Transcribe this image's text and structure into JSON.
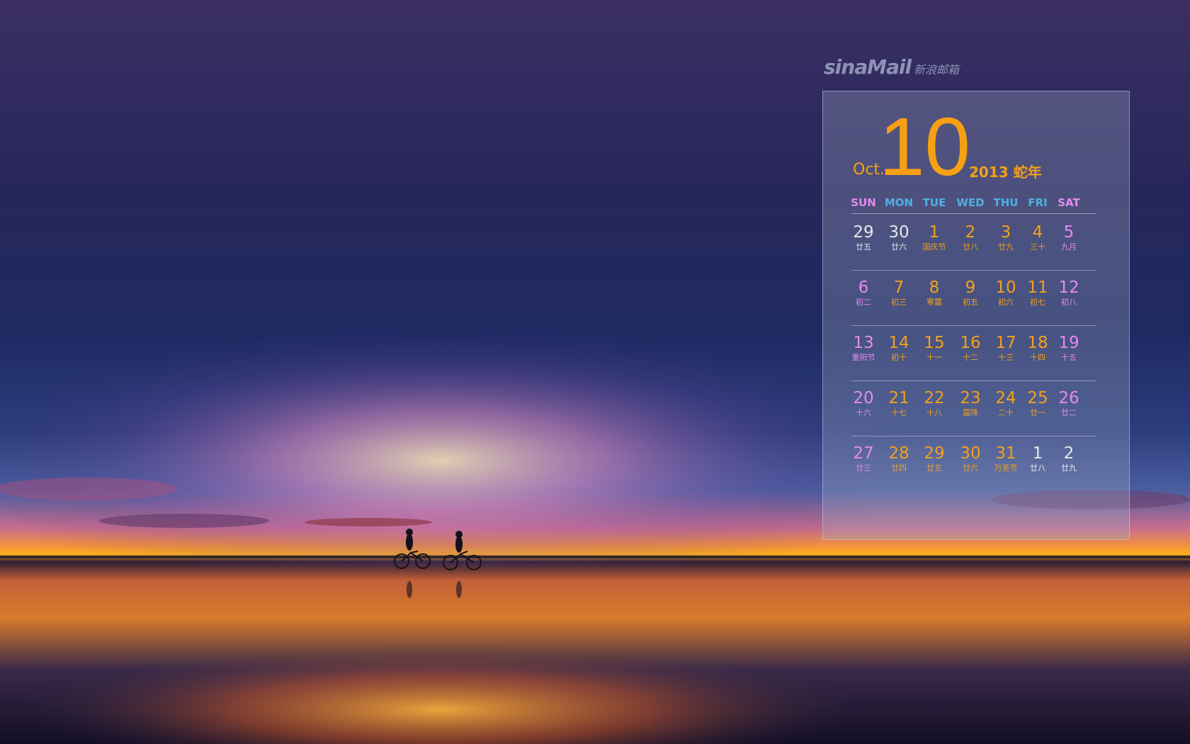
{
  "logo": {
    "mark": "sinaMail",
    "subtitle": "新浪邮箱"
  },
  "calendar": {
    "month_name": "Oct.",
    "month_number": "10",
    "year_label": "2013 蛇年",
    "weekdays": [
      {
        "label": "SUN",
        "color": "#e58af0"
      },
      {
        "label": "MON",
        "color": "#4fb0e0"
      },
      {
        "label": "TUE",
        "color": "#4fb0e0"
      },
      {
        "label": "WED",
        "color": "#4fb0e0"
      },
      {
        "label": "THU",
        "color": "#4fb0e0"
      },
      {
        "label": "FRI",
        "color": "#4fb0e0"
      },
      {
        "label": "SAT",
        "color": "#e58af0"
      }
    ],
    "weeks": [
      [
        {
          "n": "29",
          "l": "廿五",
          "c": "#e6e6ee"
        },
        {
          "n": "30",
          "l": "廿六",
          "c": "#e6e6ee"
        },
        {
          "n": "1",
          "l": "国庆节",
          "c": "#f3a01a"
        },
        {
          "n": "2",
          "l": "廿八",
          "c": "#f3a01a"
        },
        {
          "n": "3",
          "l": "廿九",
          "c": "#f3a01a"
        },
        {
          "n": "4",
          "l": "三十",
          "c": "#f3a01a"
        },
        {
          "n": "5",
          "l": "九月",
          "c": "#e58af0"
        }
      ],
      [
        {
          "n": "6",
          "l": "初二",
          "c": "#e58af0"
        },
        {
          "n": "7",
          "l": "初三",
          "c": "#f3a01a"
        },
        {
          "n": "8",
          "l": "寒露",
          "c": "#f3a01a"
        },
        {
          "n": "9",
          "l": "初五",
          "c": "#f3a01a"
        },
        {
          "n": "10",
          "l": "初六",
          "c": "#f3a01a"
        },
        {
          "n": "11",
          "l": "初七",
          "c": "#f3a01a"
        },
        {
          "n": "12",
          "l": "初八",
          "c": "#e58af0"
        }
      ],
      [
        {
          "n": "13",
          "l": "重阳节",
          "c": "#e58af0"
        },
        {
          "n": "14",
          "l": "初十",
          "c": "#f3a01a"
        },
        {
          "n": "15",
          "l": "十一",
          "c": "#f3a01a"
        },
        {
          "n": "16",
          "l": "十二",
          "c": "#f3a01a"
        },
        {
          "n": "17",
          "l": "十三",
          "c": "#f3a01a"
        },
        {
          "n": "18",
          "l": "十四",
          "c": "#f3a01a"
        },
        {
          "n": "19",
          "l": "十五",
          "c": "#e58af0"
        }
      ],
      [
        {
          "n": "20",
          "l": "十六",
          "c": "#e58af0"
        },
        {
          "n": "21",
          "l": "十七",
          "c": "#f3a01a"
        },
        {
          "n": "22",
          "l": "十八",
          "c": "#f3a01a"
        },
        {
          "n": "23",
          "l": "霜降",
          "c": "#f3a01a"
        },
        {
          "n": "24",
          "l": "二十",
          "c": "#f3a01a"
        },
        {
          "n": "25",
          "l": "廿一",
          "c": "#f3a01a"
        },
        {
          "n": "26",
          "l": "廿二",
          "c": "#e58af0"
        }
      ],
      [
        {
          "n": "27",
          "l": "廿三",
          "c": "#e58af0"
        },
        {
          "n": "28",
          "l": "廿四",
          "c": "#f3a01a"
        },
        {
          "n": "29",
          "l": "廿五",
          "c": "#f3a01a"
        },
        {
          "n": "30",
          "l": "廿六",
          "c": "#f3a01a"
        },
        {
          "n": "31",
          "l": "万圣节",
          "c": "#f3a01a"
        },
        {
          "n": "1",
          "l": "廿八",
          "c": "#e6e6ee"
        },
        {
          "n": "2",
          "l": "廿九",
          "c": "#e6e6ee"
        }
      ]
    ]
  }
}
